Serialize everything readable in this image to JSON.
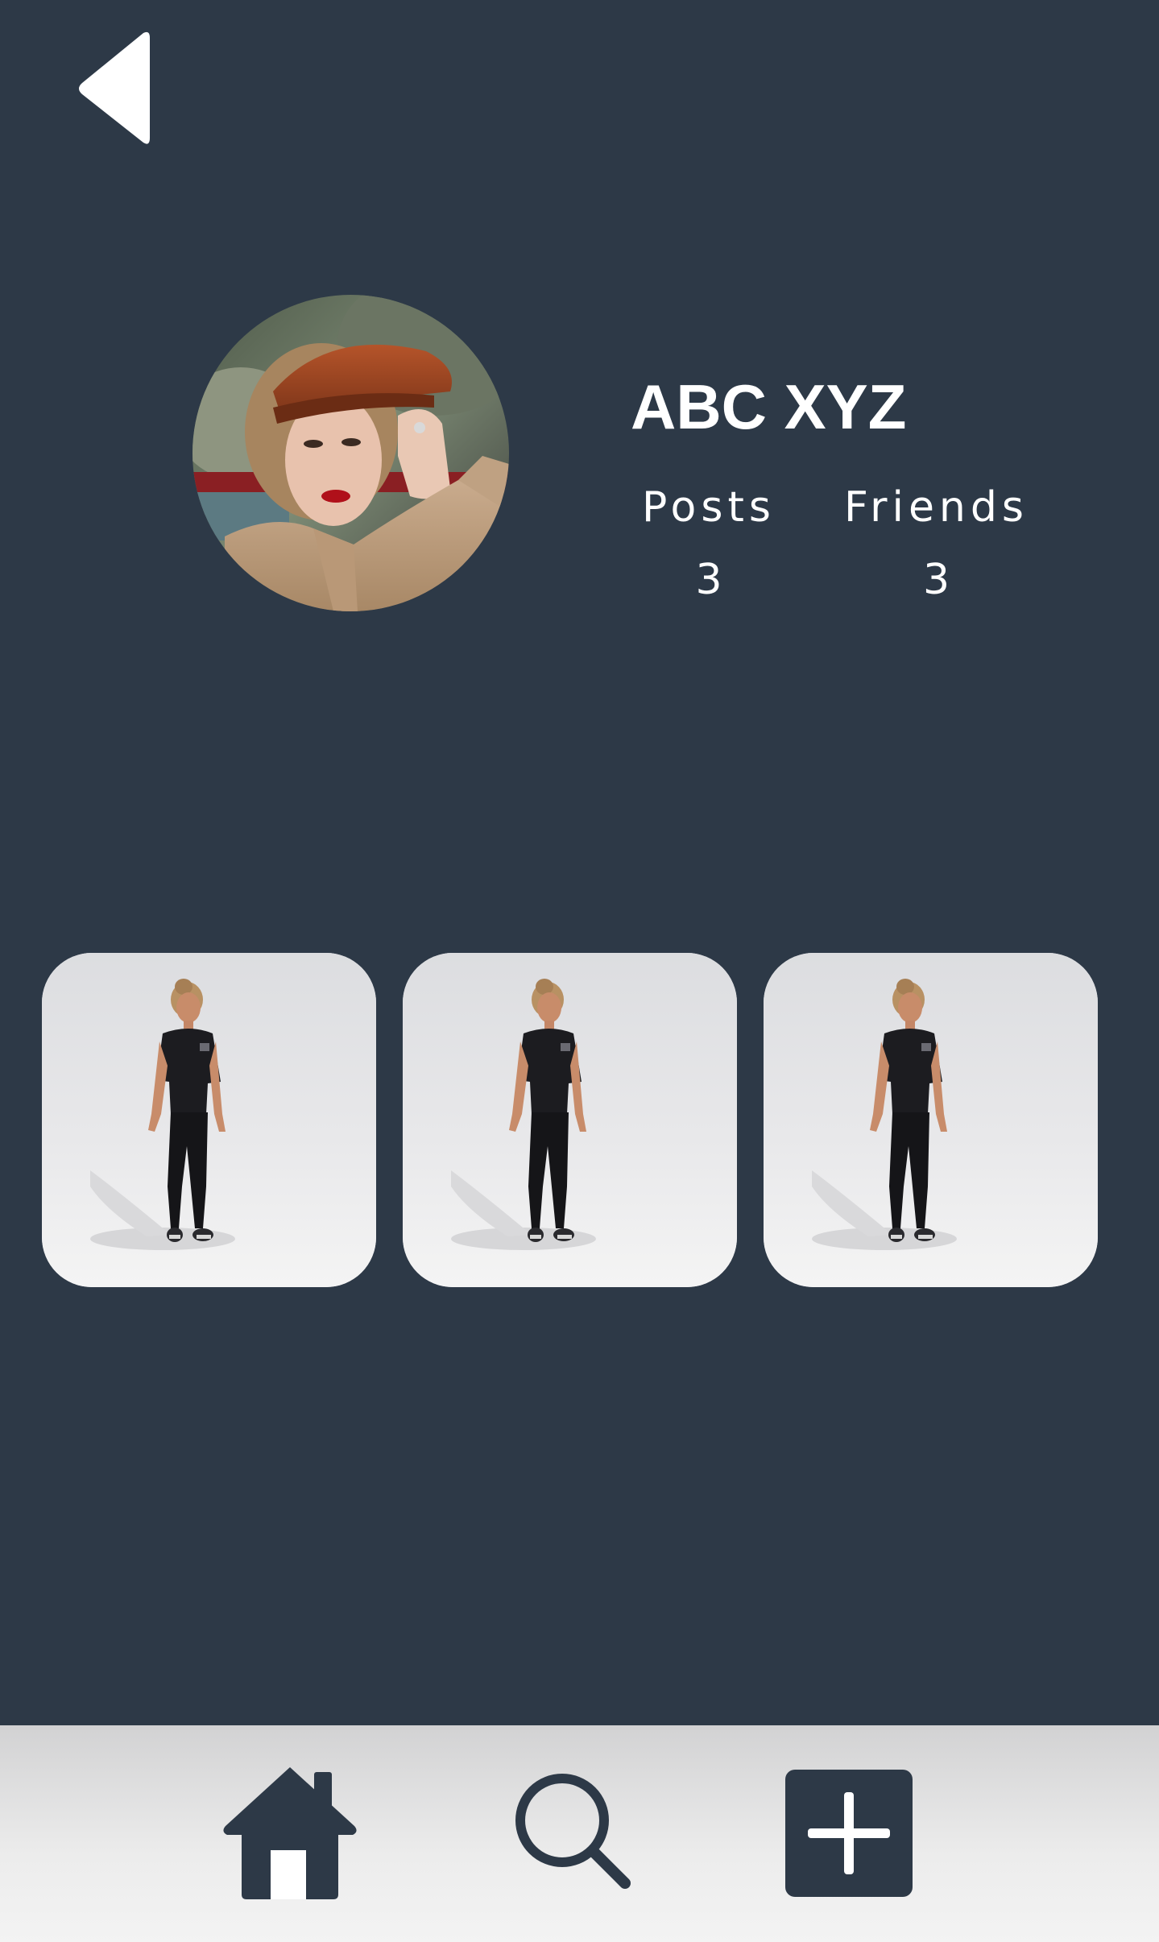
{
  "header": {
    "back_icon": "chevron-left-icon"
  },
  "profile": {
    "name": "ABC XYZ",
    "avatar_icon": "profile-photo",
    "stats": {
      "posts_label": "Posts",
      "posts_count": "3",
      "friends_label": "Friends",
      "friends_count": "3"
    }
  },
  "posts": [
    {
      "thumbnail": "avatar-figure-image"
    },
    {
      "thumbnail": "avatar-figure-image"
    },
    {
      "thumbnail": "avatar-figure-image"
    }
  ],
  "bottom_nav": {
    "items": [
      {
        "icon": "home-icon"
      },
      {
        "icon": "search-icon"
      },
      {
        "icon": "add-post-icon"
      }
    ]
  },
  "colors": {
    "background": "#2d3947",
    "nav_background": "#ececec",
    "icon_dark": "#2d3947",
    "text": "#ffffff"
  }
}
